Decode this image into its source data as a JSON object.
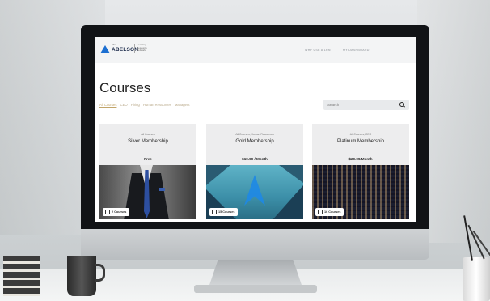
{
  "header": {
    "logo_prefix": "The",
    "logo_name": "ABELSON",
    "logo_sub": "Learning Resource Network",
    "nav": [
      "WHY USE A LRN",
      "MY DASHBOARD"
    ]
  },
  "page": {
    "title": "Courses",
    "filters": [
      {
        "label": "All Courses",
        "active": true
      },
      {
        "label": "CEO",
        "active": false
      },
      {
        "label": "Hiring",
        "active": false
      },
      {
        "label": "Human Resources",
        "active": false
      },
      {
        "label": "Managers",
        "active": false
      }
    ],
    "search_placeholder": "Search"
  },
  "cards": [
    {
      "category": "All Courses",
      "title": "Silver Membership",
      "price": "Free",
      "courses": "2 Courses"
    },
    {
      "category": "All Courses, Human Resources",
      "title": "Gold Membership",
      "price": "$19.99 / Month",
      "courses": "15 Courses"
    },
    {
      "category": "All Courses, CEO",
      "title": "Platinum Membership",
      "price": "$29.99/Month",
      "courses": "16 Courses"
    }
  ],
  "colors": {
    "accent": "#c2a56a",
    "brand": "#1c6fd1"
  },
  "icons": {
    "search": "search-icon",
    "courses": "book-icon"
  }
}
